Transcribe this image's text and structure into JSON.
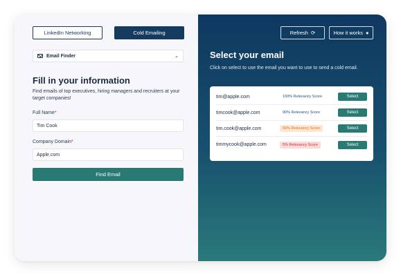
{
  "tabs": {
    "linkedin_label": "LinkedIn Networking",
    "cold_email_label": "Cold Emailing"
  },
  "dropdown": {
    "value": "Email Finder"
  },
  "form": {
    "heading": "Fill in your information",
    "subtitle": "Find emails of top executives, hiring managers and recruiters at your target companies!",
    "full_name_label": "Full Name",
    "full_name_value": "Tim Cook",
    "domain_label": "Company Domain",
    "domain_value": "Apple.com",
    "required_mark": "*",
    "submit_label": "Find Email"
  },
  "right": {
    "refresh_label": "Refresh",
    "how_label": "How it works",
    "title": "Select your email",
    "subtitle": "Click on select to use the email you want to use to send a cold email.",
    "select_label": "Select",
    "results": [
      {
        "email": "tim@apple.com",
        "score": "100% Relevancy Score",
        "level": "good"
      },
      {
        "email": "timcook@apple.com",
        "score": "90% Relevancy Score",
        "level": "good"
      },
      {
        "email": "tim.cook@apple.com",
        "score": "50% Relevancy Score",
        "level": "mid"
      },
      {
        "email": "timmycook@apple.com",
        "score": "5% Relevancy Score",
        "level": "bad"
      }
    ]
  },
  "colors": {
    "primary": "#2a7a74",
    "navy": "#143a5e",
    "warning": "#d9731f",
    "danger": "#d62d2d"
  },
  "icons": {
    "dropdown": "mail-icon",
    "refresh": "refresh-icon",
    "how": "lightbulb-icon",
    "chevron": "chevron-down-icon"
  }
}
